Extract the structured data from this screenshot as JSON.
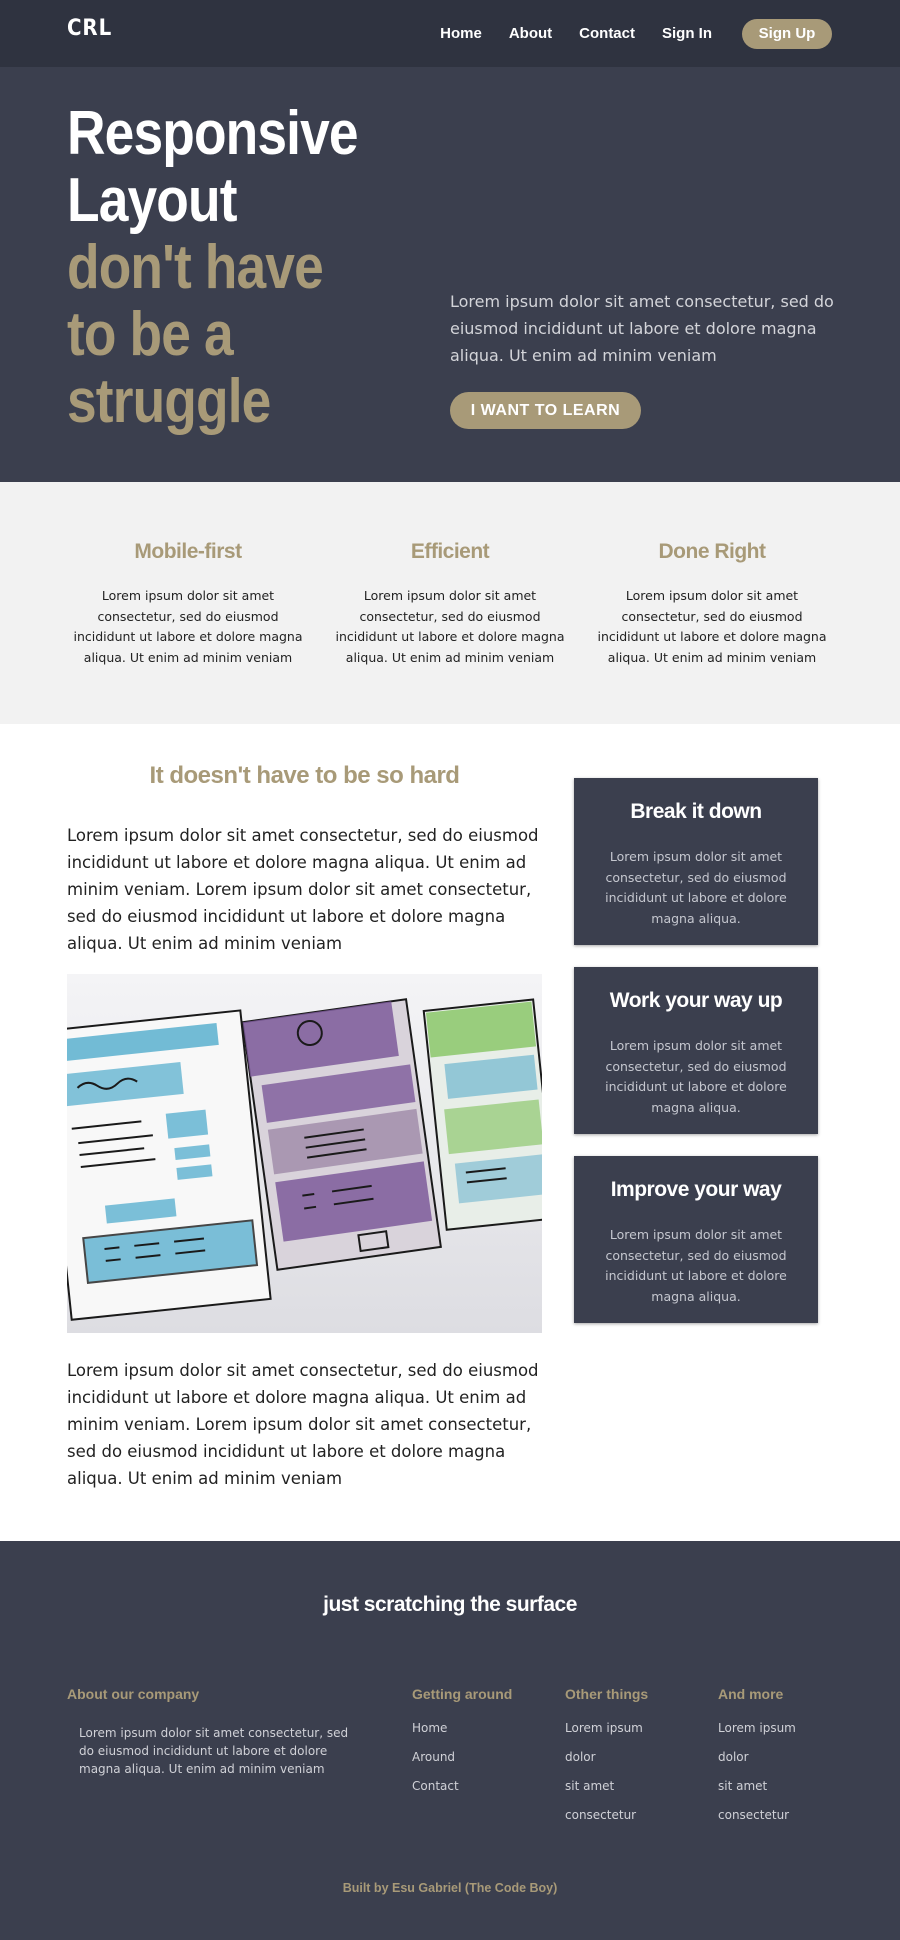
{
  "nav": {
    "logo": "CRL",
    "links": [
      "Home",
      "About",
      "Contact",
      "Sign In"
    ],
    "signup": "Sign Up"
  },
  "hero": {
    "title_white": [
      "Responsive",
      "Layout"
    ],
    "title_tan": [
      "don't have",
      "to be a",
      "struggle"
    ],
    "text": "Lorem ipsum dolor sit amet consectetur, sed do eiusmod incididunt ut labore et dolore magna aliqua. Ut enim ad minim veniam",
    "button": "I WANT TO LEARN"
  },
  "features": [
    {
      "title": "Mobile-first",
      "text": "Lorem ipsum dolor sit amet consectetur, sed do eiusmod incididunt ut labore et dolore magna aliqua. Ut enim ad minim veniam"
    },
    {
      "title": "Efficient",
      "text": "Lorem ipsum dolor sit amet consectetur, sed do eiusmod incididunt ut labore et dolore magna aliqua. Ut enim ad minim veniam"
    },
    {
      "title": "Done Right",
      "text": "Lorem ipsum dolor sit amet consectetur, sed do eiusmod incididunt ut labore et dolore magna aliqua. Ut enim ad minim veniam"
    }
  ],
  "main": {
    "heading": "It doesn't have to be so hard",
    "para1": "Lorem ipsum dolor sit amet consectetur, sed do eiusmod incididunt ut labore et dolore magna aliqua. Ut enim ad minim veniam. Lorem ipsum dolor sit amet consectetur, sed do eiusmod incididunt ut labore et dolore magna aliqua. Ut enim ad minim veniam",
    "para2": "Lorem ipsum dolor sit amet consectetur, sed do eiusmod incididunt ut labore et dolore magna aliqua. Ut enim ad minim veniam. Lorem ipsum dolor sit amet consectetur, sed do eiusmod incididunt ut labore et dolore magna aliqua. Ut enim ad minim veniam"
  },
  "cards": [
    {
      "title": "Break it down",
      "text": "Lorem ipsum dolor sit amet consectetur, sed do eiusmod incididunt ut labore et dolore magna aliqua."
    },
    {
      "title": "Work your way up",
      "text": "Lorem ipsum dolor sit amet consectetur, sed do eiusmod incididunt ut labore et dolore magna aliqua."
    },
    {
      "title": "Improve your way",
      "text": "Lorem ipsum dolor sit amet consectetur, sed do eiusmod incididunt ut labore et dolore magna aliqua."
    }
  ],
  "footer": {
    "title": "just scratching the surface",
    "about_heading": "About our company",
    "about_text": "Lorem ipsum dolor sit amet consectetur, sed do eiusmod incididunt ut labore et dolore magna aliqua. Ut enim ad minim veniam",
    "columns": [
      {
        "heading": "Getting around",
        "links": [
          "Home",
          "Around",
          "Contact"
        ]
      },
      {
        "heading": "Other things",
        "links": [
          "Lorem ipsum",
          "dolor",
          "sit amet",
          "consectetur"
        ]
      },
      {
        "heading": "And more",
        "links": [
          "Lorem ipsum",
          "dolor",
          "sit amet",
          "consectetur"
        ]
      }
    ],
    "credit": "Built by Esu Gabriel (The Code Boy)"
  },
  "colors": {
    "accent": "#a89a78",
    "dark": "#3b3f4e",
    "nav": "#2f3340",
    "light_bg": "#f2f2f2"
  }
}
